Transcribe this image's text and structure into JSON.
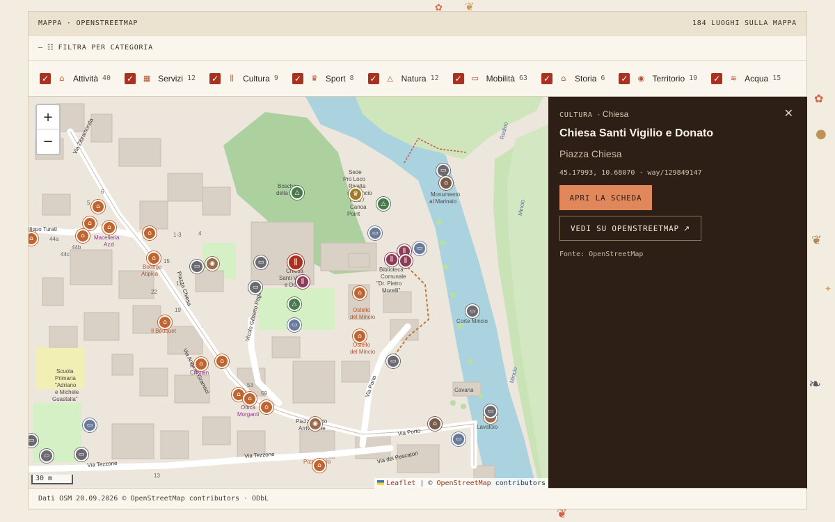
{
  "header": {
    "title": "MAPPA · OPENSTREETMAP",
    "count": "184 LUOGHI SULLA MAPPA"
  },
  "filter": {
    "toggle_symbol": "–",
    "label": "FILTRA PER CATEGORIA"
  },
  "categories": [
    {
      "label": "Attività",
      "count": "40",
      "icon": "shop-icon",
      "glyph": "⌂",
      "checked": true
    },
    {
      "label": "Servizi",
      "count": "12",
      "icon": "building-icon",
      "glyph": "▦",
      "checked": true
    },
    {
      "label": "Cultura",
      "count": "9",
      "icon": "books-icon",
      "glyph": "⫼",
      "checked": true
    },
    {
      "label": "Sport",
      "count": "8",
      "icon": "trophy-icon",
      "glyph": "♛",
      "checked": true
    },
    {
      "label": "Natura",
      "count": "12",
      "icon": "tree-icon",
      "glyph": "△",
      "checked": true
    },
    {
      "label": "Mobilità",
      "count": "63",
      "icon": "bus-icon",
      "glyph": "▭",
      "checked": true
    },
    {
      "label": "Storia",
      "count": "6",
      "icon": "monument-icon",
      "glyph": "⌂",
      "checked": true
    },
    {
      "label": "Territorio",
      "count": "19",
      "icon": "pin-icon",
      "glyph": "◉",
      "checked": true
    },
    {
      "label": "Acqua",
      "count": "15",
      "icon": "waves-icon",
      "glyph": "≋",
      "checked": true
    }
  ],
  "map": {
    "zoom_in": "+",
    "zoom_out": "−",
    "scale": "30 m",
    "attribution": {
      "leaflet": "Leaflet",
      "sep": "|",
      "copy": "©",
      "osm": "OpenStreetMap",
      "contrib": "contributors"
    },
    "street_labels": [
      "Via Zibramonda",
      "ilippo Turati",
      "Piazza Chiesa",
      "Via Antonio Gramsci",
      "Vicolo Gilberto Pagliari",
      "Via Porto",
      "Via Porto",
      "Via Tezzone",
      "Via Tezzone",
      "Via dei Pescatori",
      "Mincio",
      "Mincio",
      "Rodino"
    ],
    "place_labels": [
      "Sede",
      "Pro Loco",
      "Rivalta",
      "sul Mincio",
      "APS /",
      "Canoa",
      "Point",
      "Bosche",
      "della C...",
      "Monumento",
      "al Marinaio",
      "Biblioteca",
      "Comunale",
      "\"Dr. Pietro",
      "Morelli\"",
      "Chiesa",
      "Santi V...",
      "e Do...",
      "Ostello",
      "del Mincio",
      "Ostello",
      "del Mincio",
      "Corte Mincio",
      "Macelleria",
      "Azzi",
      "Bottega",
      "Atipica",
      "Il Bouquet",
      "Rivaroli",
      "Cristian",
      "Ottica",
      "Morganti",
      "Scuola",
      "Primaria",
      "\"Adriano",
      "e Michele",
      "Guastalla\"",
      "Piazza Silvio",
      "Arrivabene",
      "Pizzangolo",
      "Cavana",
      "Lavatoio"
    ],
    "house_numbers": [
      "6",
      "5",
      "44a",
      "44b",
      "44c",
      "1-3",
      "4",
      "15",
      "11",
      "22",
      "19",
      "53",
      "59",
      "13"
    ]
  },
  "detail": {
    "category": "CULTURA",
    "subcategory": "· Chiesa",
    "title": "Chiesa Santi Vigilio e Donato",
    "address": "Piazza Chiesa",
    "coords": "45.17993, 10.68070 · way/129849147",
    "open_label": "APRI LA SCHEDA",
    "osm_label": "VEDI SU OPENSTREETMAP",
    "source": "Fonte: OpenStreetMap"
  },
  "footer": {
    "text": "Dati OSM 20.09.2026  © OpenStreetMap contributors · ODbL"
  },
  "colors": {
    "accent": "#a8321f",
    "panel": "#2d1f16",
    "button": "#e0875c",
    "water": "#a9d3df",
    "park": "#c8e2b0",
    "building": "#d9d0c6"
  }
}
